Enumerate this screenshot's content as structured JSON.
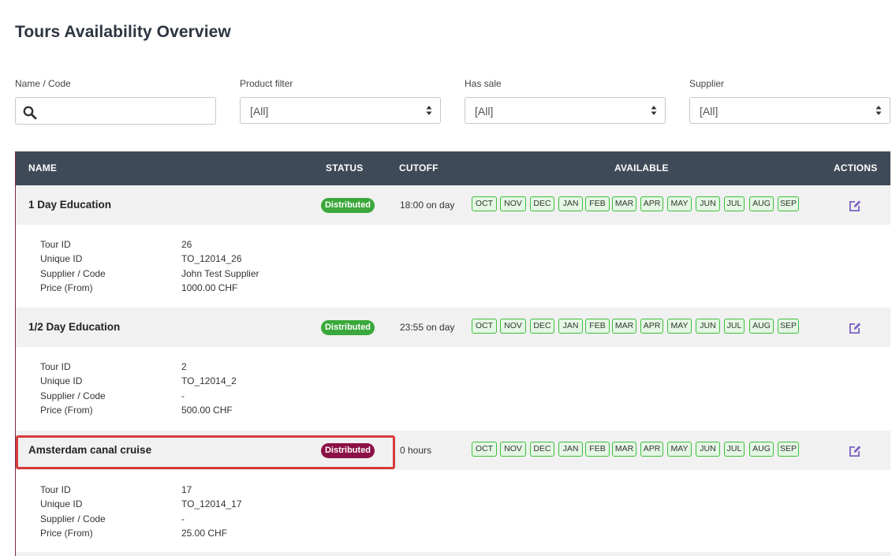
{
  "page": {
    "title": "Tours Availability Overview"
  },
  "filters": {
    "name_code": {
      "label": "Name / Code",
      "value": "",
      "placeholder": ""
    },
    "product": {
      "label": "Product filter",
      "value": "[All]"
    },
    "has_sale": {
      "label": "Has sale",
      "value": "[All]"
    },
    "supplier": {
      "label": "Supplier",
      "value": "[All]"
    }
  },
  "table": {
    "headers": {
      "name": "NAME",
      "status": "STATUS",
      "cutoff": "CUTOFF",
      "available": "AVAILABLE",
      "actions": "ACTIONS"
    },
    "detail_labels": {
      "tour_id": "Tour ID",
      "unique_id": "Unique ID",
      "supplier_code": "Supplier / Code",
      "price_from": "Price (From)"
    },
    "rows": [
      {
        "name": "1 Day Education",
        "status": "Distributed",
        "status_color": "#3aa83a",
        "cutoff": "18:00 on day",
        "months": [
          "OCT",
          "NOV",
          "DEC",
          "JAN",
          "FEB",
          "MAR",
          "APR",
          "MAY",
          "JUN",
          "JUL",
          "AUG",
          "SEP"
        ],
        "tour_id": "26",
        "unique_id": "TO_12014_26",
        "supplier_code": "John Test Supplier",
        "price_from": "1000.00 CHF"
      },
      {
        "name": "1/2 Day Education",
        "status": "Distributed",
        "status_color": "#3aa83a",
        "cutoff": "23:55 on day",
        "months": [
          "OCT",
          "NOV",
          "DEC",
          "JAN",
          "FEB",
          "MAR",
          "APR",
          "MAY",
          "JUN",
          "JUL",
          "AUG",
          "SEP"
        ],
        "tour_id": "2",
        "unique_id": "TO_12014_2",
        "supplier_code": "-",
        "price_from": "500.00 CHF"
      },
      {
        "name": "Amsterdam canal cruise",
        "status": "Distributed",
        "status_color": "#8c1146",
        "cutoff": "0 hours",
        "months": [
          "OCT",
          "NOV",
          "DEC",
          "JAN",
          "FEB",
          "MAR",
          "APR",
          "MAY",
          "JUN",
          "JUL",
          "AUG",
          "SEP"
        ],
        "tour_id": "17",
        "unique_id": "TO_12014_17",
        "supplier_code": "-",
        "price_from": "25.00 CHF"
      }
    ]
  },
  "colors": {
    "header_bg": "#3e4a57",
    "month_border": "#3cbf3c",
    "month_bg": "#e4f7e4",
    "edit_icon": "#7b62c4",
    "highlight": "#d83a3a"
  },
  "icons": {
    "search": "search-icon",
    "select": "sort-arrows-icon",
    "edit": "edit-icon"
  }
}
